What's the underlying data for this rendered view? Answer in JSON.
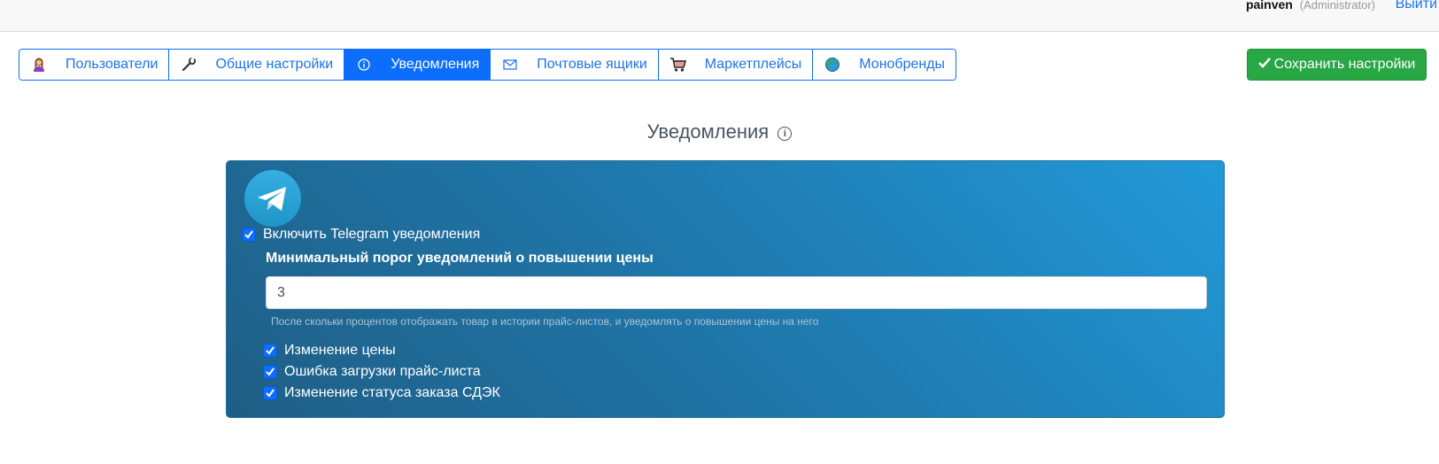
{
  "header": {
    "username": "painven",
    "role": "(Administrator)",
    "logout_label": "Выйти"
  },
  "tabs": [
    {
      "label": "Пользователи",
      "icon": "woman-user-icon",
      "active": false
    },
    {
      "label": "Общие настройки",
      "icon": "wrench-icon",
      "active": false
    },
    {
      "label": "Уведомления",
      "icon": "info-icon",
      "active": true
    },
    {
      "label": "Почтовые ящики",
      "icon": "envelope-icon",
      "active": false
    },
    {
      "label": "Маркетплейсы",
      "icon": "shopping-cart-icon",
      "active": false
    },
    {
      "label": "Монобренды",
      "icon": "globe-icon",
      "active": false
    }
  ],
  "save_button": {
    "label": "Сохранить настройки",
    "icon": "check-icon",
    "color": "#28a745"
  },
  "section": {
    "title": "Уведомления",
    "icon": "info-icon"
  },
  "telegram": {
    "logo_icon": "telegram-icon",
    "enable_label": "Включить Telegram уведомления",
    "enable_checked": true,
    "threshold_label": "Минимальный порог уведомлений о повышении цены",
    "threshold_value": "3",
    "threshold_help": "После скольки процентов отображать товар в истории прайс-листов, и уведомлять о повышении цены на него",
    "options": [
      {
        "label": "Изменение цены",
        "checked": true
      },
      {
        "label": "Ошибка загрузки прайс-листа",
        "checked": true
      },
      {
        "label": "Изменение статуса заказа СДЭК",
        "checked": true
      }
    ]
  },
  "colors": {
    "accent": "#0d6efd",
    "panel_dark": "#1f5e85",
    "panel_light": "#2299d8"
  }
}
